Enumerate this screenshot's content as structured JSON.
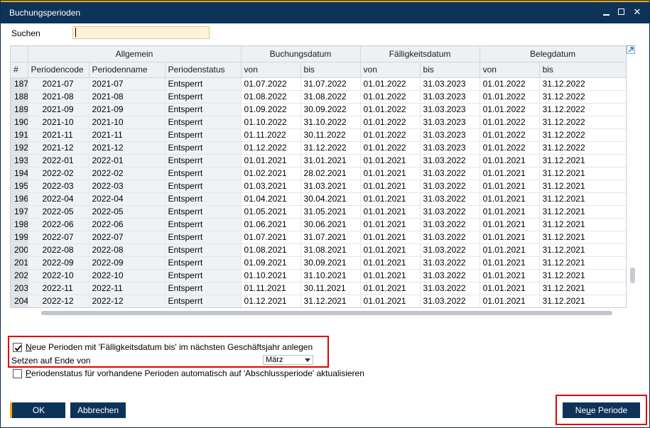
{
  "window": {
    "title": "Buchungsperioden"
  },
  "search": {
    "label": "Suchen",
    "value": ""
  },
  "table": {
    "group_headers": [
      "Allgemein",
      "Buchungsdatum",
      "Fälligkeitsdatum",
      "Belegdatum"
    ],
    "columns": [
      "#",
      "Periodencode",
      "Periodenname",
      "Periodenstatus",
      "von",
      "bis",
      "von",
      "bis",
      "von",
      "bis"
    ],
    "rows": [
      [
        "187",
        "2021-07",
        "2021-07",
        "Entsperrt",
        "01.07.2022",
        "31.07.2022",
        "01.01.2022",
        "31.03.2023",
        "01.01.2022",
        "31.12.2022"
      ],
      [
        "188",
        "2021-08",
        "2021-08",
        "Entsperrt",
        "01.08.2022",
        "31.08.2022",
        "01.01.2022",
        "31.03.2023",
        "01.01.2022",
        "31.12.2022"
      ],
      [
        "189",
        "2021-09",
        "2021-09",
        "Entsperrt",
        "01.09.2022",
        "30.09.2022",
        "01.01.2022",
        "31.03.2023",
        "01.01.2022",
        "31.12.2022"
      ],
      [
        "190",
        "2021-10",
        "2021-10",
        "Entsperrt",
        "01.10.2022",
        "31.10.2022",
        "01.01.2022",
        "31.03.2023",
        "01.01.2022",
        "31.12.2022"
      ],
      [
        "191",
        "2021-11",
        "2021-11",
        "Entsperrt",
        "01.11.2022",
        "30.11.2022",
        "01.01.2022",
        "31.03.2023",
        "01.01.2022",
        "31.12.2022"
      ],
      [
        "192",
        "2021-12",
        "2021-12",
        "Entsperrt",
        "01.12.2022",
        "31.12.2022",
        "01.01.2022",
        "31.03.2023",
        "01.01.2022",
        "31.12.2022"
      ],
      [
        "193",
        "2022-01",
        "2022-01",
        "Entsperrt",
        "01.01.2021",
        "31.01.2021",
        "01.01.2021",
        "31.03.2022",
        "01.01.2021",
        "31.12.2021"
      ],
      [
        "194",
        "2022-02",
        "2022-02",
        "Entsperrt",
        "01.02.2021",
        "28.02.2021",
        "01.01.2021",
        "31.03.2022",
        "01.01.2021",
        "31.12.2021"
      ],
      [
        "195",
        "2022-03",
        "2022-03",
        "Entsperrt",
        "01.03.2021",
        "31.03.2021",
        "01.01.2021",
        "31.03.2022",
        "01.01.2021",
        "31.12.2021"
      ],
      [
        "196",
        "2022-04",
        "2022-04",
        "Entsperrt",
        "01.04.2021",
        "30.04.2021",
        "01.01.2021",
        "31.03.2022",
        "01.01.2021",
        "31.12.2021"
      ],
      [
        "197",
        "2022-05",
        "2022-05",
        "Entsperrt",
        "01.05.2021",
        "31.05.2021",
        "01.01.2021",
        "31.03.2022",
        "01.01.2021",
        "31.12.2021"
      ],
      [
        "198",
        "2022-06",
        "2022-06",
        "Entsperrt",
        "01.06.2021",
        "30.06.2021",
        "01.01.2021",
        "31.03.2022",
        "01.01.2021",
        "31.12.2021"
      ],
      [
        "199",
        "2022-07",
        "2022-07",
        "Entsperrt",
        "01.07.2021",
        "31.07.2021",
        "01.01.2021",
        "31.03.2022",
        "01.01.2021",
        "31.12.2021"
      ],
      [
        "200",
        "2022-08",
        "2022-08",
        "Entsperrt",
        "01.08.2021",
        "31.08.2021",
        "01.01.2021",
        "31.03.2022",
        "01.01.2021",
        "31.12.2021"
      ],
      [
        "201",
        "2022-09",
        "2022-09",
        "Entsperrt",
        "01.09.2021",
        "30.09.2021",
        "01.01.2021",
        "31.03.2022",
        "01.01.2021",
        "31.12.2021"
      ],
      [
        "202",
        "2022-10",
        "2022-10",
        "Entsperrt",
        "01.10.2021",
        "31.10.2021",
        "01.01.2021",
        "31.03.2022",
        "01.01.2021",
        "31.12.2021"
      ],
      [
        "203",
        "2022-11",
        "2022-11",
        "Entsperrt",
        "01.11.2021",
        "30.11.2021",
        "01.01.2021",
        "31.03.2022",
        "01.01.2021",
        "31.12.2021"
      ],
      [
        "204",
        "2022-12",
        "2022-12",
        "Entsperrt",
        "01.12.2021",
        "31.12.2021",
        "01.01.2021",
        "31.03.2022",
        "01.01.2021",
        "31.12.2021"
      ]
    ]
  },
  "options": {
    "new_periods_label": "Neue Perioden mit 'Fälligkeitsdatum bis' im nächsten Geschäftsjahr anlegen",
    "new_periods_checked": true,
    "set_end_label": "Setzen auf Ende von",
    "month_value": "März",
    "auto_status_label": "Periodenstatus für vorhandene Perioden automatisch auf 'Abschlussperiode' aktualisieren",
    "auto_status_checked": false
  },
  "buttons": {
    "ok": "OK",
    "cancel": "Abbrechen",
    "new_period": "Neue Periode"
  },
  "colors": {
    "titlebar": "#0e3358",
    "accent": "#f0ab00",
    "highlight": "#e00000",
    "arrow": "#f0a30a"
  }
}
